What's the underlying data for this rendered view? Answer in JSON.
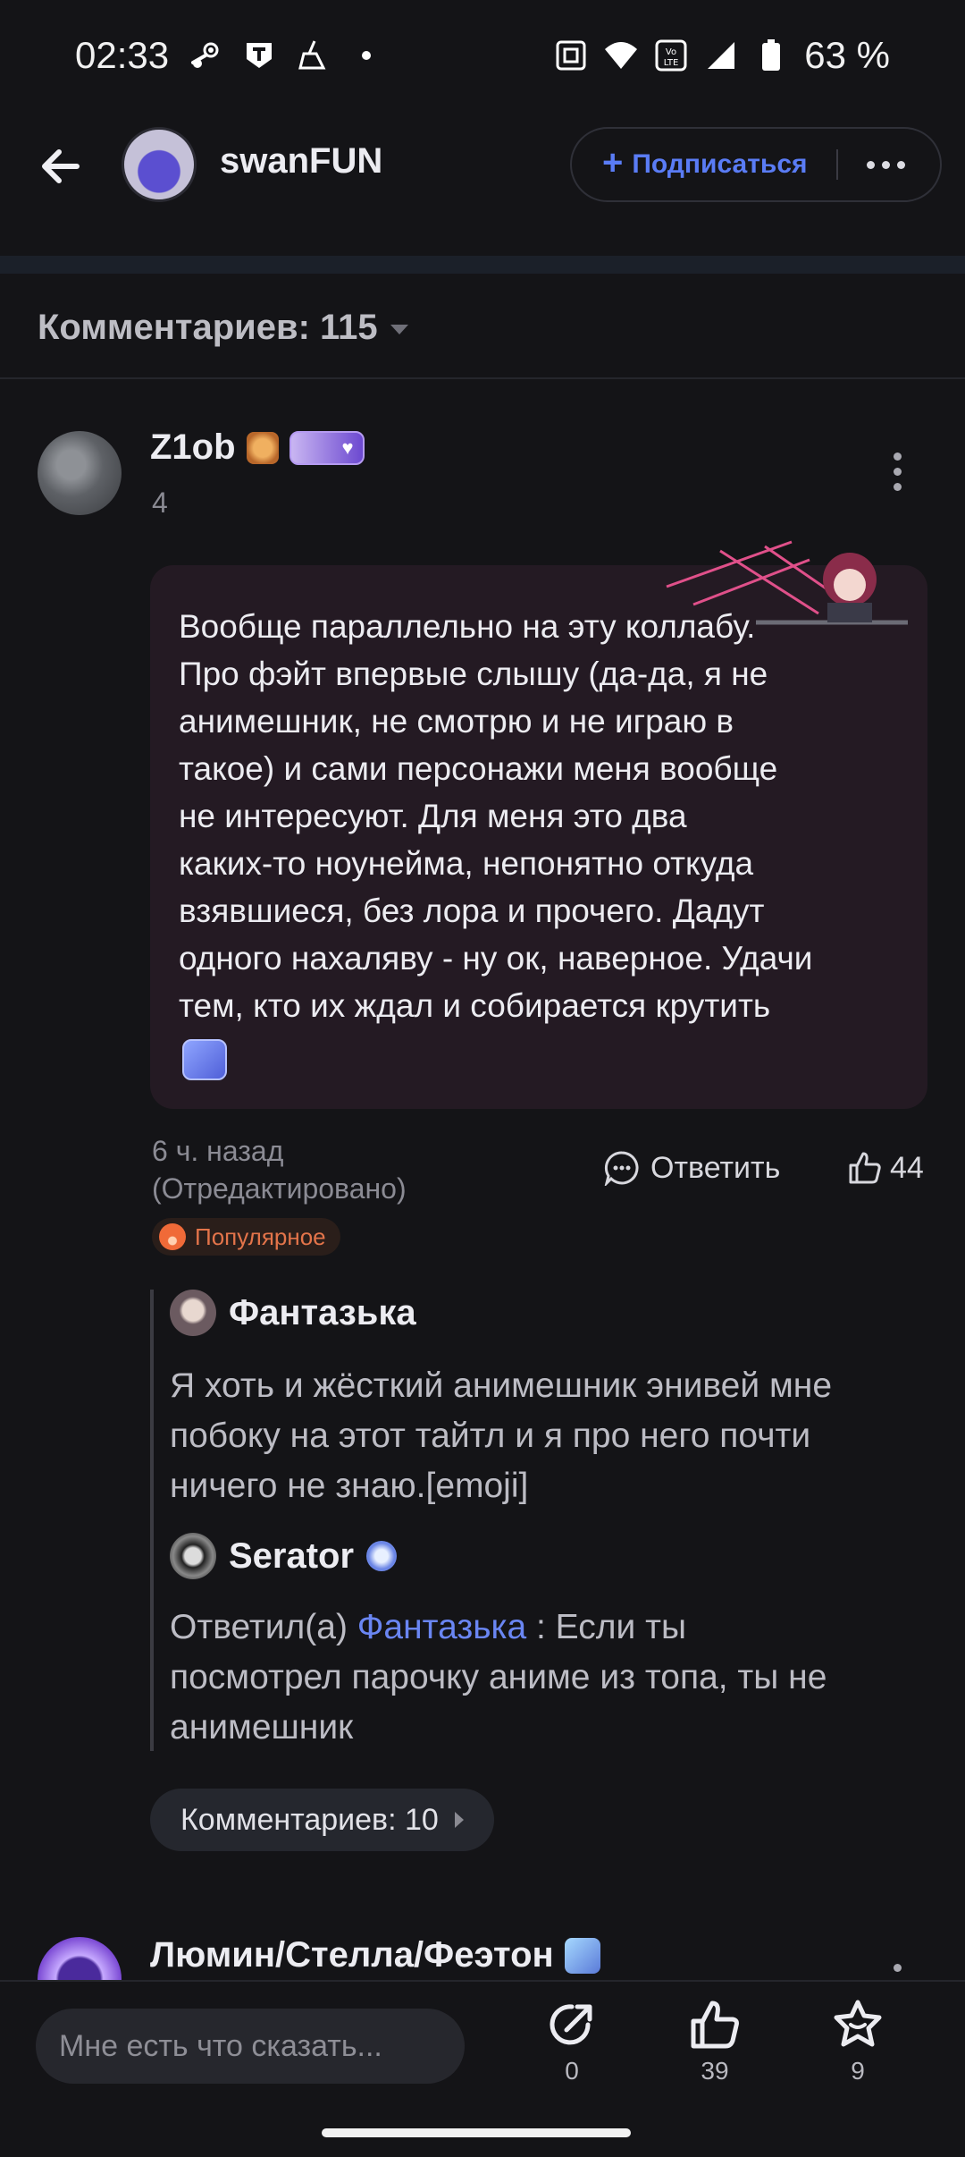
{
  "status_bar": {
    "time": "02:33",
    "battery_text": "63 %",
    "left_icons": [
      "steam-icon",
      "app-t-icon",
      "broom-icon",
      "dot-icon"
    ],
    "right_icons": [
      "nfc-icon",
      "wifi-icon",
      "volte-icon",
      "signal-icon",
      "battery-icon"
    ]
  },
  "header": {
    "channel_name": "swanFUN",
    "subscribe_label": "Подписаться"
  },
  "comments_header": {
    "label": "Комментариев: 115"
  },
  "comment": {
    "author": "Z1ob",
    "level": "4",
    "text": "Вообще параллельно на эту коллабу.\nПро фэйт впервые слышу (да-да, я не\nанимешник, не смотрю и не играю в\nтакое) и сами персонажи меня вообще\nне интересуют. Для меня это два\nкаких-то ноунейма, непонятно откуда\nвзявшиеся, без лора и прочего. Дадут\nодного нахаляву - ну ок, наверное. Удачи\nтем, кто их ждал и собирается крутить",
    "meta": "6 ч. назад\n(Отредактировано)",
    "reply_label": "Ответить",
    "likes": "44",
    "popular_label": "Популярное"
  },
  "replies": [
    {
      "author": "Фантазька",
      "text": "Я хоть и жёсткий анимешник энивей мне\nпобоку на этот тайтл и я про него почти\nничего не знаю.[emoji]"
    },
    {
      "author": "Serator",
      "prefix": "Ответил(а) ",
      "mention": "Фантазька",
      "text": " : Если ты\nпосмотрел парочку аниме из топа, ты не\nанимешник"
    }
  ],
  "more_comments_label": "Комментариев: 10",
  "next_comment": {
    "author": "Люмин/Стелла/Феэтон"
  },
  "bottom_bar": {
    "input_placeholder": "Мне есть что сказать...",
    "share_count": "0",
    "like_count": "39",
    "favorite_count": "9"
  },
  "colors": {
    "background": "#141417",
    "accent": "#5a7cf5",
    "bubble": "#241a23",
    "popular": "#e3744a"
  }
}
